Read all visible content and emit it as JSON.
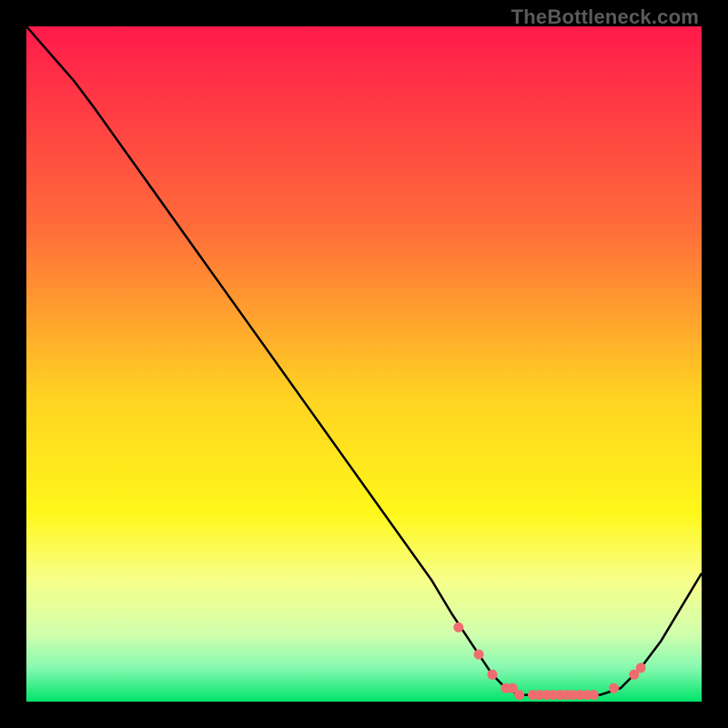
{
  "watermark": "TheBottleneck.com",
  "colors": {
    "gradient_stops": [
      {
        "offset": 0.0,
        "color": "#ff1a4b"
      },
      {
        "offset": 0.3,
        "color": "#ff6d3a"
      },
      {
        "offset": 0.55,
        "color": "#ffd322"
      },
      {
        "offset": 0.72,
        "color": "#fff71a"
      },
      {
        "offset": 0.82,
        "color": "#f7ff8a"
      },
      {
        "offset": 0.9,
        "color": "#d1ffad"
      },
      {
        "offset": 0.95,
        "color": "#86f9b0"
      },
      {
        "offset": 1.0,
        "color": "#00e46a"
      }
    ],
    "line": "#000000",
    "marker": "#ef6d70"
  },
  "chart_data": {
    "type": "line",
    "title": "",
    "xlabel": "",
    "ylabel": "",
    "xlim": [
      0,
      100
    ],
    "ylim": [
      0,
      100
    ],
    "x": [
      0,
      7,
      10,
      15,
      20,
      25,
      30,
      35,
      40,
      45,
      50,
      55,
      60,
      63,
      67,
      69,
      71,
      73,
      75,
      77,
      79,
      81,
      83,
      85,
      88,
      91,
      94,
      97,
      100
    ],
    "y": [
      100,
      92,
      88,
      81,
      74,
      67,
      60,
      53,
      46,
      39,
      32,
      25,
      18,
      13,
      7,
      4,
      2,
      1,
      1,
      1,
      1,
      1,
      1,
      1,
      2,
      5,
      9,
      14,
      19
    ],
    "markers": {
      "x": [
        64,
        67,
        69,
        71,
        72,
        73,
        75,
        76,
        77,
        78,
        79,
        80,
        81,
        82,
        83,
        84,
        87,
        90,
        91
      ],
      "y": [
        11,
        7,
        4,
        2,
        2,
        1,
        1,
        1,
        1,
        1,
        1,
        1,
        1,
        1,
        1,
        1,
        2,
        4,
        5
      ]
    }
  }
}
